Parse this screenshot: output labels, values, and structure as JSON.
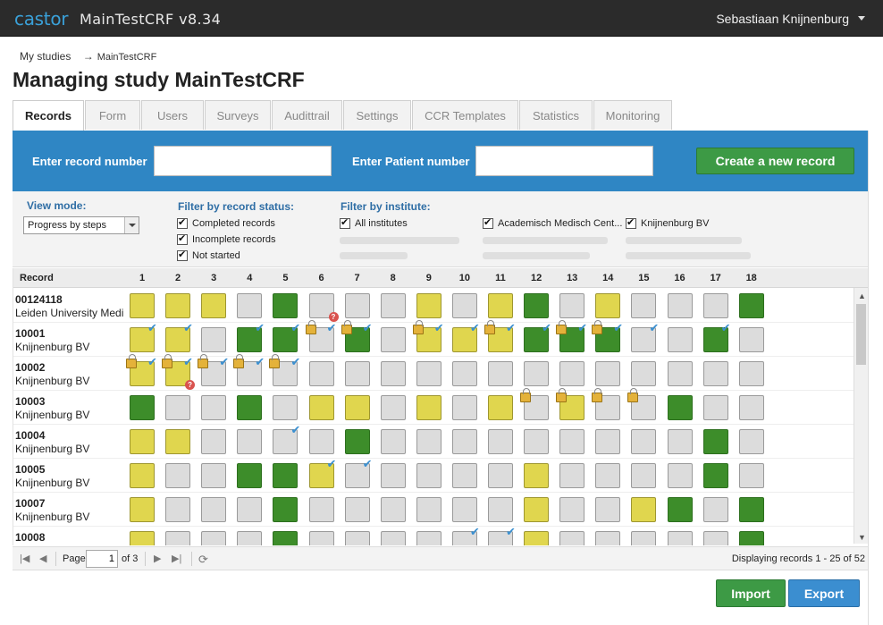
{
  "header": {
    "brand": "castor",
    "app_title": "MainTestCRF v8.34",
    "user_name": "Sebastiaan Knijnenburg"
  },
  "breadcrumb": {
    "root": "My studies",
    "arrow": "→",
    "current": "MainTestCRF"
  },
  "page_title": "Managing study MainTestCRF",
  "tabs": [
    {
      "label": "Records",
      "active": true
    },
    {
      "label": "Form"
    },
    {
      "label": "Users"
    },
    {
      "label": "Surveys"
    },
    {
      "label": "Audittrail"
    },
    {
      "label": "Settings"
    },
    {
      "label": "CCR Templates"
    },
    {
      "label": "Statistics"
    },
    {
      "label": "Monitoring"
    }
  ],
  "search": {
    "record_label": "Enter record number",
    "record_value": "",
    "patient_label": "Enter Patient number",
    "patient_value": "",
    "create_button": "Create a new record"
  },
  "filters": {
    "view_mode_label": "View mode:",
    "view_mode_value": "Progress by steps",
    "status_label": "Filter by record status:",
    "status_options": [
      {
        "label": "Completed records",
        "checked": true
      },
      {
        "label": "Incomplete records",
        "checked": true
      },
      {
        "label": "Not started",
        "checked": true
      }
    ],
    "institute_label": "Filter by institute:",
    "institute_options": [
      {
        "label": "All institutes",
        "checked": true
      },
      {
        "label": "Academisch Medisch Cent...",
        "checked": true
      },
      {
        "label": "Knijnenburg BV",
        "checked": true
      }
    ]
  },
  "grid": {
    "record_header": "Record",
    "columns": [
      "1",
      "2",
      "3",
      "4",
      "5",
      "6",
      "7",
      "8",
      "9",
      "10",
      "11",
      "12",
      "13",
      "14",
      "15",
      "16",
      "17",
      "18"
    ],
    "legend_colors": {
      "g": "#3d8d2a",
      "y": "#e0d64e",
      "e": "#dcdcdc"
    },
    "rows": [
      {
        "id": "00124118",
        "institute": "Leiden University Medi",
        "cells": "yyyegeeeyeygeyeeeg",
        "checks": [],
        "locks": [],
        "queries": [
          6
        ]
      },
      {
        "id": "10001",
        "institute": "Knijnenburg BV",
        "cells": "yyeggegeyyygggeege",
        "checks": [
          1,
          2,
          4,
          5,
          6,
          7,
          9,
          10,
          11,
          12,
          13,
          14,
          15,
          17
        ],
        "locks": [
          6,
          7,
          9,
          11,
          13,
          14
        ],
        "queries": []
      },
      {
        "id": "10002",
        "institute": "Knijnenburg BV",
        "cells": "yyeeeeeeeeeeeeeeee",
        "checks": [
          1,
          2,
          3,
          4,
          5
        ],
        "locks": [
          1,
          2,
          3,
          4,
          5
        ],
        "queries": [
          2
        ]
      },
      {
        "id": "10003",
        "institute": "Knijnenburg BV",
        "cells": "geegeyyeyeyeyeegee",
        "checks": [],
        "locks": [
          12,
          13,
          14,
          15
        ],
        "queries": []
      },
      {
        "id": "10004",
        "institute": "Knijnenburg BV",
        "cells": "yyeeeegeeeeeeeeege",
        "checks": [
          5
        ],
        "locks": [],
        "queries": []
      },
      {
        "id": "10005",
        "institute": "Knijnenburg BV",
        "cells": "yeeggyeeeeeyeeeege",
        "checks": [
          6,
          7
        ],
        "locks": [],
        "queries": []
      },
      {
        "id": "10007",
        "institute": "Knijnenburg BV",
        "cells": "yeeegeeeeeeyeeygeg",
        "checks": [],
        "locks": [],
        "queries": []
      },
      {
        "id": "10008",
        "institute": "",
        "cells": "yeeegeeeeeeyeeeeeg",
        "checks": [
          10,
          11
        ],
        "locks": [],
        "queries": []
      }
    ]
  },
  "pager": {
    "page_label": "Page",
    "page_value": "1",
    "of_label": "of 3",
    "display_text": "Displaying records 1 - 25 of 52"
  },
  "footer": {
    "import_label": "Import",
    "export_label": "Export"
  }
}
